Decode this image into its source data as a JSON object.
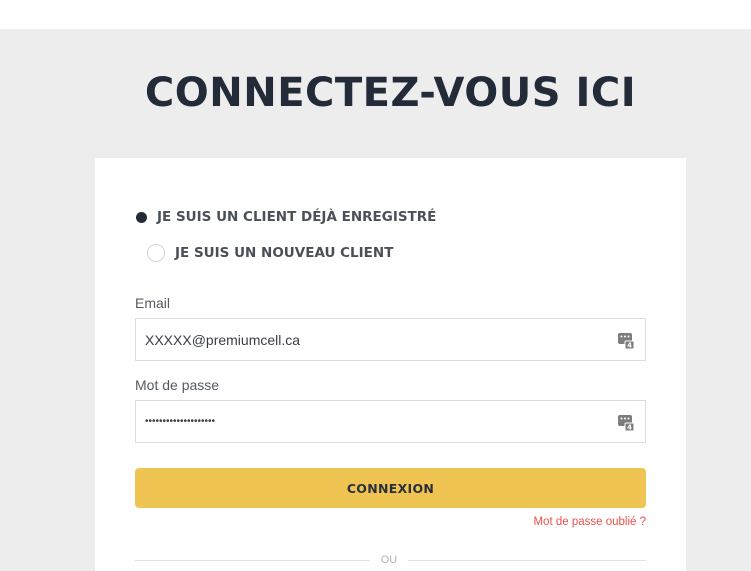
{
  "page": {
    "title": "CONNECTEZ-VOUS ICI"
  },
  "customer_type": {
    "options": [
      {
        "label": "JE SUIS UN CLIENT DÉJÀ ENREGISTRÉ",
        "selected": true
      },
      {
        "label": "JE SUIS UN NOUVEAU CLIENT",
        "selected": false
      }
    ]
  },
  "form": {
    "email_label": "Email",
    "email_value": "XXXXX@premiumcell.ca",
    "password_label": "Mot de passe",
    "password_value": "••••••••••••••••••••",
    "login_button": "CONNEXION",
    "forgot_link": "Mot de passe oublié ?",
    "divider_text": "OU"
  },
  "colors": {
    "accent": "#f0c453",
    "link": "#e8514d",
    "title": "#232b39",
    "background": "#ededed"
  },
  "icons": {
    "field_icon": "password-manager-key-icon"
  }
}
